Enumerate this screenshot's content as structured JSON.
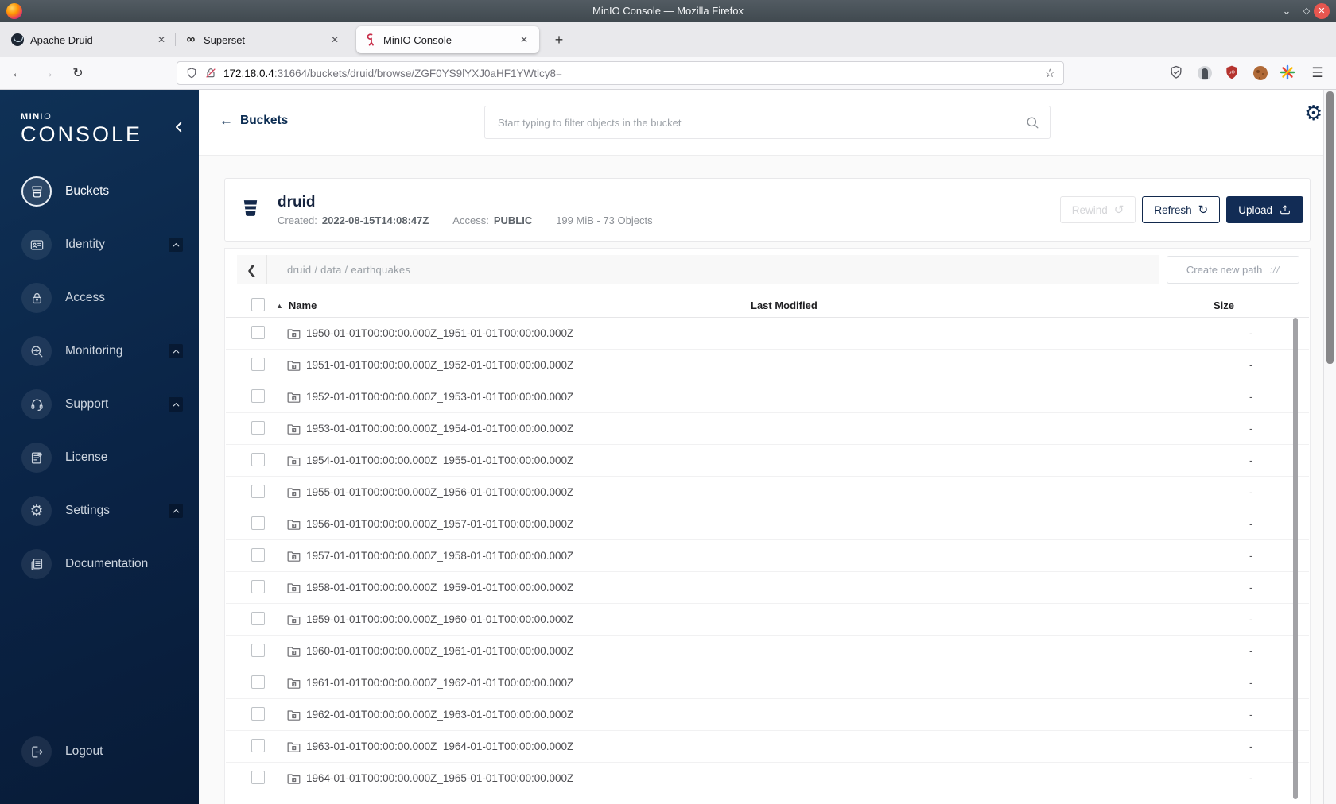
{
  "colors": {
    "accent_navy": "#122c55",
    "sidebar_top": "#0f3156",
    "sidebar_bottom": "#081b37",
    "minio_red": "#c72c48",
    "ublock_red": "#b5332e",
    "close_button_red": "#e8564f"
  },
  "browser": {
    "titlebar": {
      "title": "MinIO Console — Mozilla Firefox",
      "minimize": "⌄",
      "maximize": "◇",
      "close": "✕"
    },
    "tabs": [
      {
        "label": "Apache Druid",
        "close": "✕"
      },
      {
        "label": "Superset",
        "close": "✕",
        "favicon_glyph": "∞"
      },
      {
        "label": "MinIO Console",
        "close": "✕",
        "active": true
      }
    ],
    "new_tab": "+",
    "nav": {
      "back": "←",
      "forward": "→",
      "reload": "↻"
    },
    "urlbar": {
      "host": "172.18.0.4",
      "path": ":31664/buckets/druid/browse/ZGF0YS9lYXJ0aHF1YWtlcy8=",
      "bookmark_star": "☆"
    },
    "menu_button": "☰"
  },
  "sidebar": {
    "logo_top": "MIN",
    "logo_top_thin": "IO",
    "logo_main": "CONSOLE",
    "items": [
      {
        "label": "Buckets",
        "active": true,
        "expandable": false
      },
      {
        "label": "Identity",
        "active": false,
        "expandable": true
      },
      {
        "label": "Access",
        "active": false,
        "expandable": false
      },
      {
        "label": "Monitoring",
        "active": false,
        "expandable": true
      },
      {
        "label": "Support",
        "active": false,
        "expandable": true
      },
      {
        "label": "License",
        "active": false,
        "expandable": false
      },
      {
        "label": "Settings",
        "active": false,
        "expandable": true
      },
      {
        "label": "Documentation",
        "active": false,
        "expandable": false
      }
    ],
    "logout_label": "Logout",
    "settings_gear_glyph": "⚙"
  },
  "header": {
    "back_label": "Buckets",
    "search_placeholder": "Start typing to filter objects in the bucket",
    "gear_glyph": "⚙"
  },
  "bucket": {
    "name": "druid",
    "created_label": "Created:",
    "created_value": "2022-08-15T14:08:47Z",
    "access_label": "Access:",
    "access_value": "PUBLIC",
    "usage": "199 MiB - 73 Objects"
  },
  "toolbar": {
    "rewind_label": "Rewind",
    "rewind_glyph": "↺",
    "refresh_label": "Refresh",
    "refresh_glyph": "↻",
    "upload_label": "Upload",
    "create_path_label": "Create new path",
    "create_path_icon_glyph": "://"
  },
  "browse": {
    "back_chevron": "❮",
    "breadcrumb": "druid / data / earthquakes"
  },
  "table": {
    "sort_arrow": "▲",
    "columns": {
      "name": "Name",
      "last_modified": "Last Modified",
      "size": "Size"
    },
    "rows": [
      {
        "name": "1950-01-01T00:00:00.000Z_1951-01-01T00:00:00.000Z",
        "size": "-"
      },
      {
        "name": "1951-01-01T00:00:00.000Z_1952-01-01T00:00:00.000Z",
        "size": "-"
      },
      {
        "name": "1952-01-01T00:00:00.000Z_1953-01-01T00:00:00.000Z",
        "size": "-"
      },
      {
        "name": "1953-01-01T00:00:00.000Z_1954-01-01T00:00:00.000Z",
        "size": "-"
      },
      {
        "name": "1954-01-01T00:00:00.000Z_1955-01-01T00:00:00.000Z",
        "size": "-"
      },
      {
        "name": "1955-01-01T00:00:00.000Z_1956-01-01T00:00:00.000Z",
        "size": "-"
      },
      {
        "name": "1956-01-01T00:00:00.000Z_1957-01-01T00:00:00.000Z",
        "size": "-"
      },
      {
        "name": "1957-01-01T00:00:00.000Z_1958-01-01T00:00:00.000Z",
        "size": "-"
      },
      {
        "name": "1958-01-01T00:00:00.000Z_1959-01-01T00:00:00.000Z",
        "size": "-"
      },
      {
        "name": "1959-01-01T00:00:00.000Z_1960-01-01T00:00:00.000Z",
        "size": "-"
      },
      {
        "name": "1960-01-01T00:00:00.000Z_1961-01-01T00:00:00.000Z",
        "size": "-"
      },
      {
        "name": "1961-01-01T00:00:00.000Z_1962-01-01T00:00:00.000Z",
        "size": "-"
      },
      {
        "name": "1962-01-01T00:00:00.000Z_1963-01-01T00:00:00.000Z",
        "size": "-"
      },
      {
        "name": "1963-01-01T00:00:00.000Z_1964-01-01T00:00:00.000Z",
        "size": "-"
      },
      {
        "name": "1964-01-01T00:00:00.000Z_1965-01-01T00:00:00.000Z",
        "size": "-"
      }
    ]
  }
}
